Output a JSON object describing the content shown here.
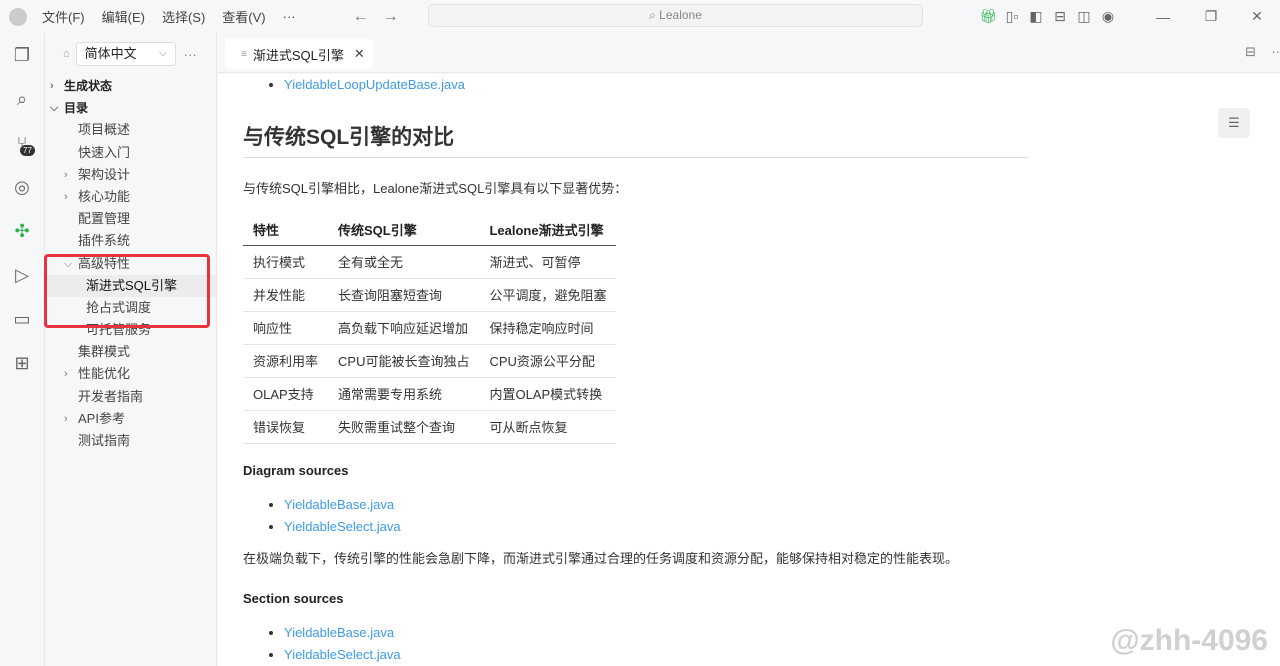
{
  "menu": [
    "文件(F)",
    "编辑(E)",
    "选择(S)",
    "查看(V)",
    "···"
  ],
  "search": {
    "placeholder": "Lealone"
  },
  "activity": {
    "scm_badge": "77"
  },
  "sidebar": {
    "language": "简体中文",
    "more": "···",
    "items": [
      {
        "label": "生成状态",
        "level": 0,
        "twisty": ">",
        "bold": true
      },
      {
        "label": "目录",
        "level": 0,
        "twisty": "v",
        "bold": true
      },
      {
        "label": "项目概述",
        "level": 1
      },
      {
        "label": "快速入门",
        "level": 1
      },
      {
        "label": "架构设计",
        "level": 1,
        "twisty": ">"
      },
      {
        "label": "核心功能",
        "level": 1,
        "twisty": ">"
      },
      {
        "label": "配置管理",
        "level": 1
      },
      {
        "label": "插件系统",
        "level": 1
      },
      {
        "label": "高级特性",
        "level": 1,
        "twisty": "v"
      },
      {
        "label": "渐进式SQL引擎",
        "level": 2,
        "active": true
      },
      {
        "label": "抢占式调度",
        "level": 2
      },
      {
        "label": "可托管服务",
        "level": 2
      },
      {
        "label": "集群模式",
        "level": 1
      },
      {
        "label": "性能优化",
        "level": 1,
        "twisty": ">"
      },
      {
        "label": "开发者指南",
        "level": 1
      },
      {
        "label": "API参考",
        "level": 1,
        "twisty": ">"
      },
      {
        "label": "测试指南",
        "level": 1
      }
    ]
  },
  "tab": {
    "label": "渐进式SQL引擎",
    "close": "✕"
  },
  "doc": {
    "top_link": "YieldableLoopUpdateBase.java",
    "heading": "与传统SQL引擎的对比",
    "intro": "与传统SQL引擎相比，Lealone渐进式SQL引擎具有以下显著优势：",
    "table": {
      "headers": [
        "特性",
        "传统SQL引擎",
        "Lealone渐进式引擎"
      ],
      "rows": [
        [
          "执行模式",
          "全有或全无",
          "渐进式、可暂停"
        ],
        [
          "并发性能",
          "长查询阻塞短查询",
          "公平调度，避免阻塞"
        ],
        [
          "响应性",
          "高负载下响应延迟增加",
          "保持稳定响应时间"
        ],
        [
          "资源利用率",
          "CPU可能被长查询独占",
          "CPU资源公平分配"
        ],
        [
          "OLAP支持",
          "通常需要专用系统",
          "内置OLAP模式转换"
        ],
        [
          "错误恢复",
          "失败需重试整个查询",
          "可从断点恢复"
        ]
      ]
    },
    "diagram_sources": "Diagram sources",
    "diagram_links": [
      "YieldableBase.java",
      "YieldableSelect.java"
    ],
    "para": "在极端负载下，传统引擎的性能会急剧下降，而渐进式引擎通过合理的任务调度和资源分配，能够保持相对稳定的性能表现。",
    "section_sources": "Section sources",
    "section_links": [
      "YieldableBase.java",
      "YieldableSelect.java"
    ]
  },
  "watermark": "@zhh-4096",
  "colors": {
    "link": "#3c9be8",
    "highlight_box": "#e8323c",
    "gift": "#2bb34a"
  }
}
